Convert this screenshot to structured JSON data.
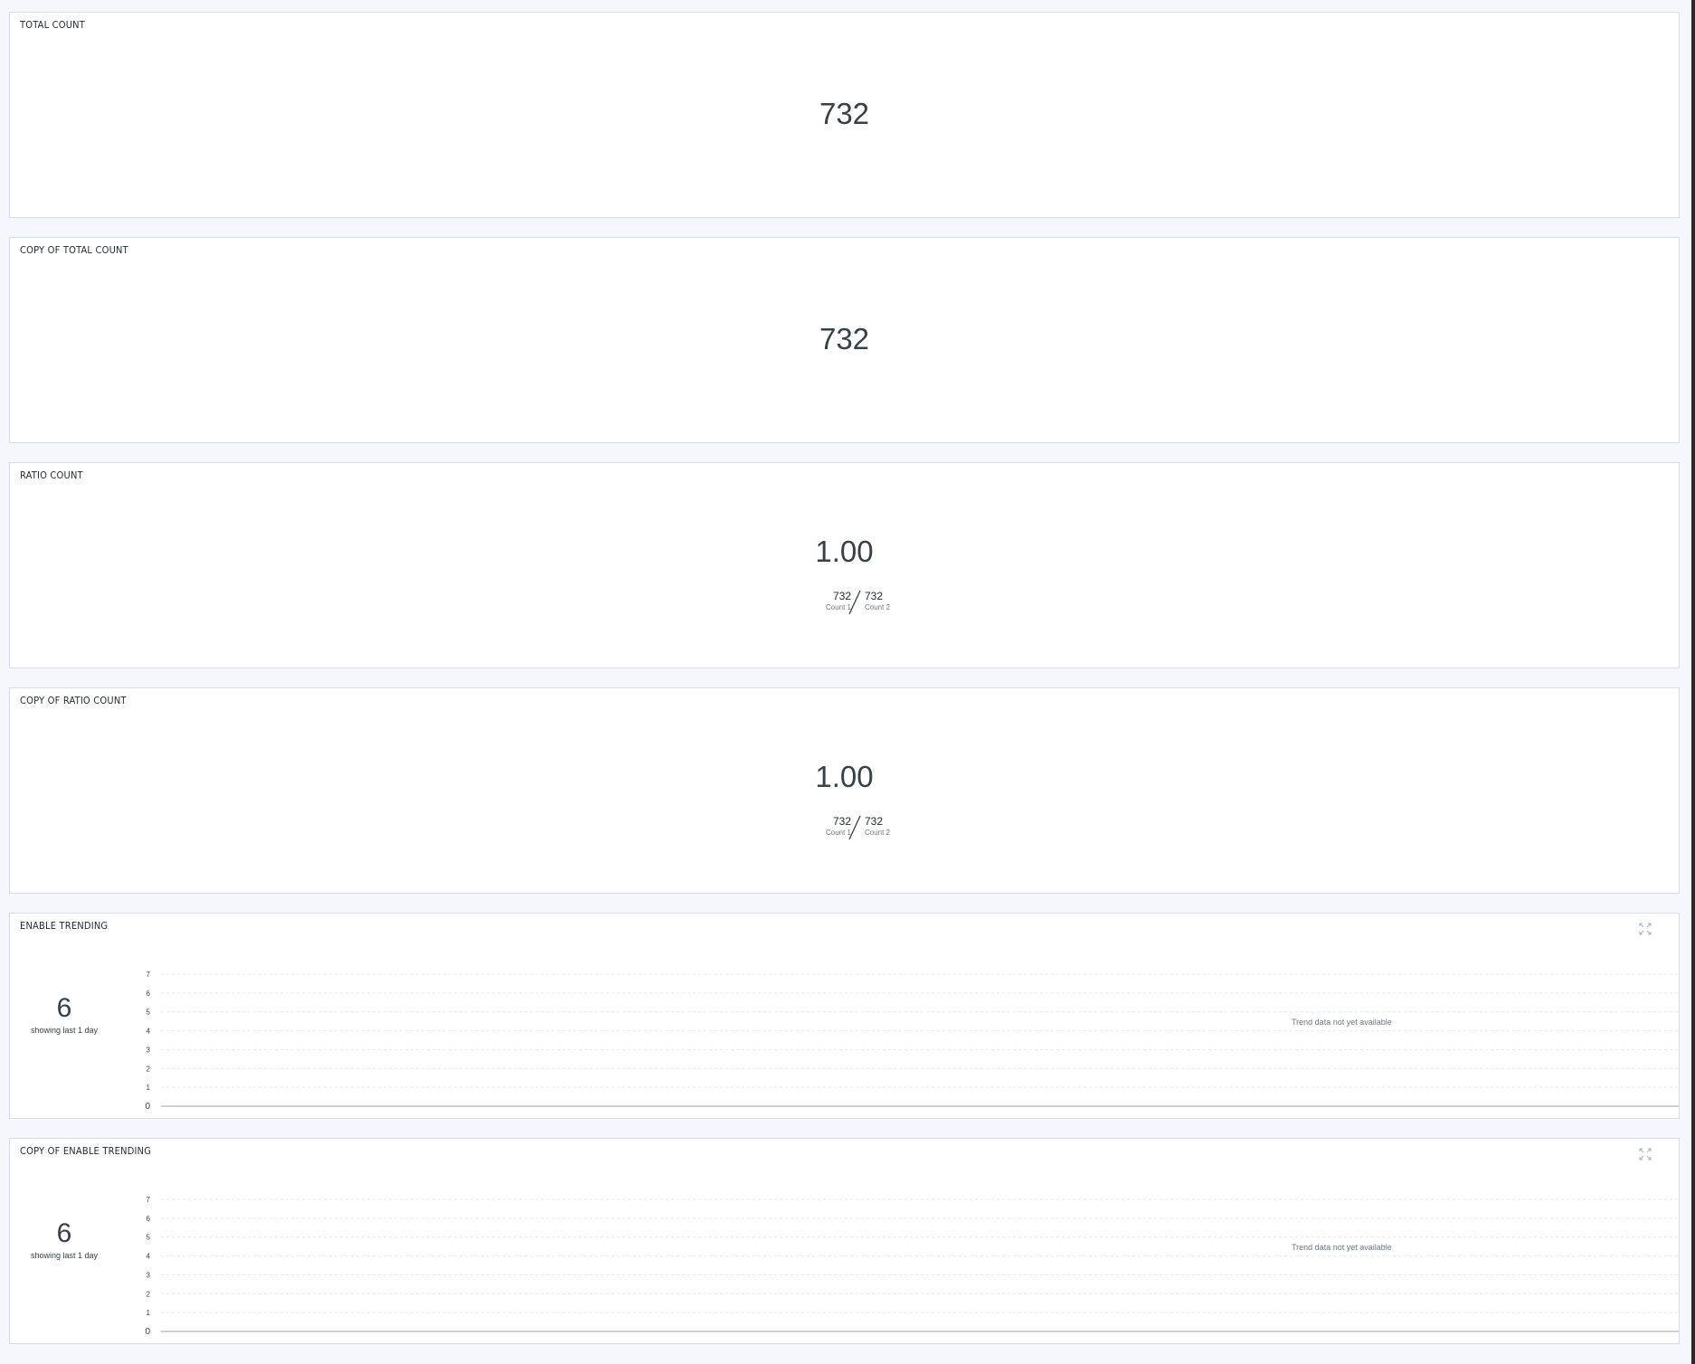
{
  "panels": [
    {
      "title": "TOTAL COUNT",
      "value": "732"
    },
    {
      "title": "COPY OF TOTAL COUNT",
      "value": "732"
    },
    {
      "title": "RATIO COUNT",
      "value": "1.00",
      "numerator": {
        "value": "732",
        "label": "Count 1"
      },
      "denominator": {
        "value": "732",
        "label": "Count 2"
      }
    },
    {
      "title": "COPY OF RATIO COUNT",
      "value": "1.00",
      "numerator": {
        "value": "732",
        "label": "Count 1"
      },
      "denominator": {
        "value": "732",
        "label": "Count 2"
      }
    },
    {
      "title": "ENABLE TRENDING",
      "value": "6",
      "subtitle": "showing last 1 day",
      "message": "Trend data not yet available",
      "expand_icon": "expand-icon"
    },
    {
      "title": "COPY OF ENABLE TRENDING",
      "value": "6",
      "subtitle": "showing last 1 day",
      "message": "Trend data not yet available",
      "expand_icon": "expand-icon"
    }
  ],
  "chart_data": [
    {
      "type": "line",
      "title": "",
      "xlabel": "",
      "ylabel": "",
      "ylim": [
        0,
        7
      ],
      "yticks": [
        "0",
        "1",
        "2",
        "3",
        "4",
        "5",
        "6",
        "7"
      ],
      "series": [],
      "grid": true
    },
    {
      "type": "line",
      "title": "",
      "xlabel": "",
      "ylabel": "",
      "ylim": [
        0,
        7
      ],
      "yticks": [
        "0",
        "1",
        "2",
        "3",
        "4",
        "5",
        "6",
        "7"
      ],
      "series": [],
      "grid": true
    }
  ],
  "colors": {
    "background": "#f5f7fc",
    "panel_border": "#d5dde8",
    "text": "#36404a"
  }
}
